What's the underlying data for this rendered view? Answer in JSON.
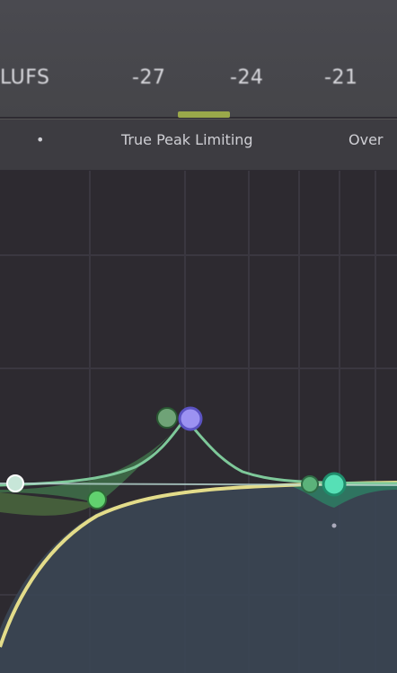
{
  "meter": {
    "unit_fragment": "LUFS",
    "ticks": [
      "-27",
      "-24",
      "-21"
    ]
  },
  "toolbar": {
    "dot": "•",
    "true_peak_label": "True Peak Limiting",
    "overflow_label": "Over"
  },
  "colors": {
    "background": "#2d2a30",
    "accent_yellow": "#e0d98a",
    "band_green": "#5fcf72",
    "band_blue": "#8e86f0",
    "band_teal": "#46d7ac",
    "fill_green": "#3a6a44"
  },
  "eq_nodes": [
    {
      "name": "band-node-1",
      "color": "light",
      "label": ""
    },
    {
      "name": "band-node-2",
      "color": "green",
      "label": ""
    },
    {
      "name": "band-node-3",
      "color": "green",
      "label": ""
    },
    {
      "name": "band-node-4",
      "color": "blue",
      "label": ""
    },
    {
      "name": "band-node-5",
      "color": "green",
      "label": ""
    },
    {
      "name": "band-node-6",
      "color": "teal",
      "label": ""
    }
  ]
}
